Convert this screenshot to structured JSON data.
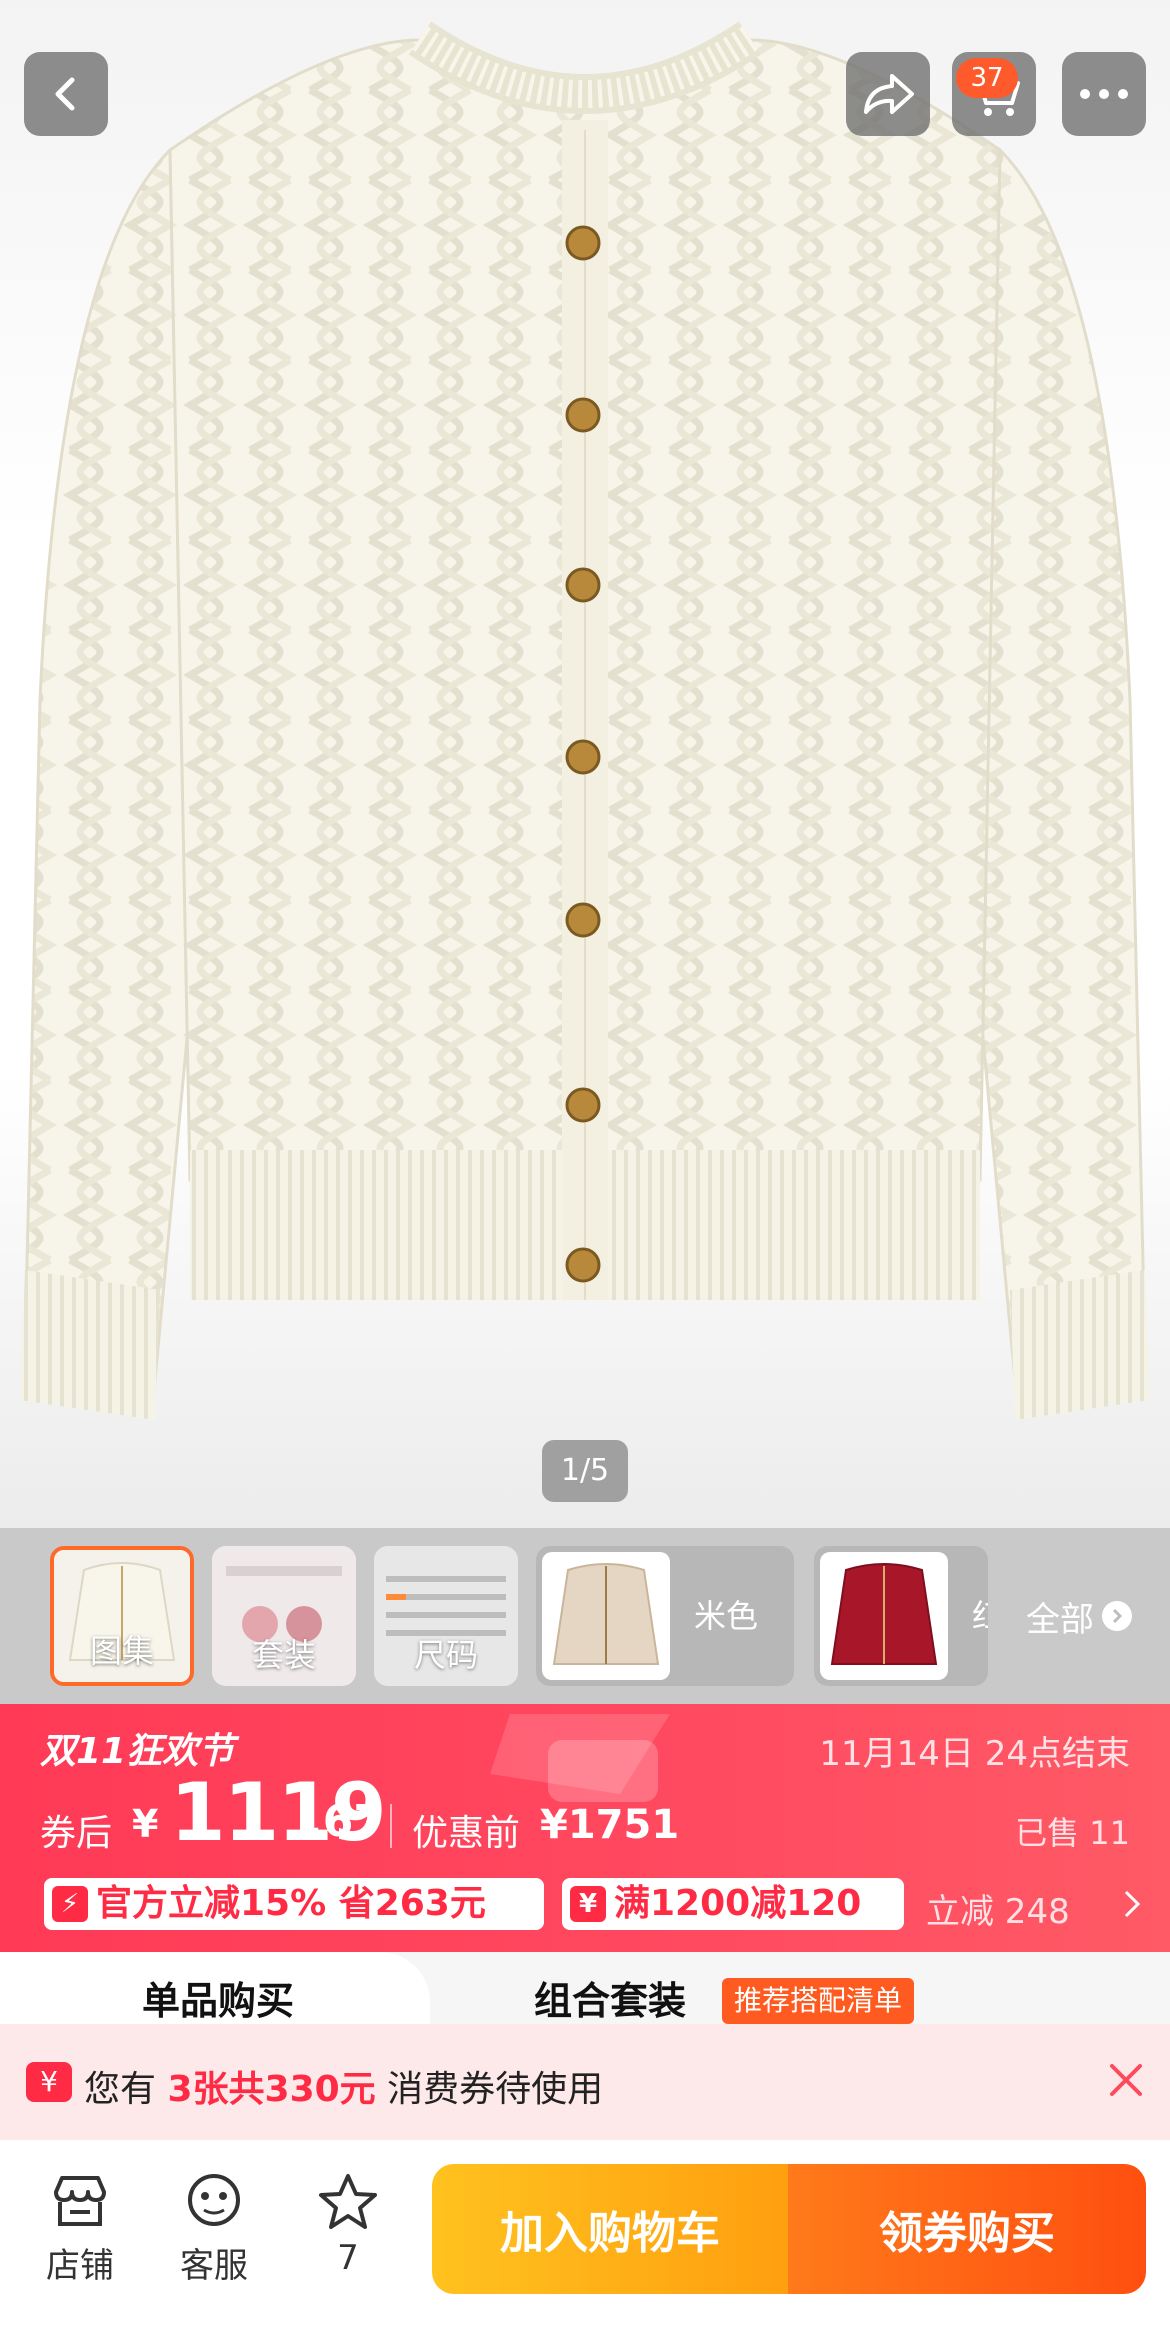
{
  "header": {
    "cart_count": "37"
  },
  "gallery": {
    "pager": "1/5",
    "thumbs": [
      {
        "label": "图集"
      },
      {
        "label": "套装"
      },
      {
        "label": "尺码"
      }
    ],
    "colors": [
      {
        "name": "米色"
      },
      {
        "name": "红"
      }
    ],
    "all_label": "全部"
  },
  "promo": {
    "festival": "双11狂欢节",
    "end_time": "11月14日 24点结束",
    "after_coupon_label": "券后",
    "yen": "¥",
    "price_int": "1119",
    "price_dec": ".67",
    "before_label": "优惠前",
    "before_price": "¥1751",
    "sold": "已售 11",
    "tag1_icon": "⚡",
    "tag1": "官方立减15% 省263元",
    "tag2_icon": "¥",
    "tag2": "满1200减120",
    "instant": "立减 248"
  },
  "tabs": {
    "single": "单品购买",
    "combo": "组合套装",
    "combo_badge": "推荐搭配清单"
  },
  "notice": {
    "icon": "¥",
    "prefix": "您有",
    "highlight": "3张共330元",
    "suffix": "消费券待使用"
  },
  "bottombar": {
    "store": "店铺",
    "service": "客服",
    "fav_count": "7",
    "add_cart": "加入购物车",
    "buy": "领券购买"
  },
  "colors": {
    "brand_red": "#ff3a56",
    "cart_btn": "#ffb01a",
    "buy_btn": "#ff5a14"
  }
}
